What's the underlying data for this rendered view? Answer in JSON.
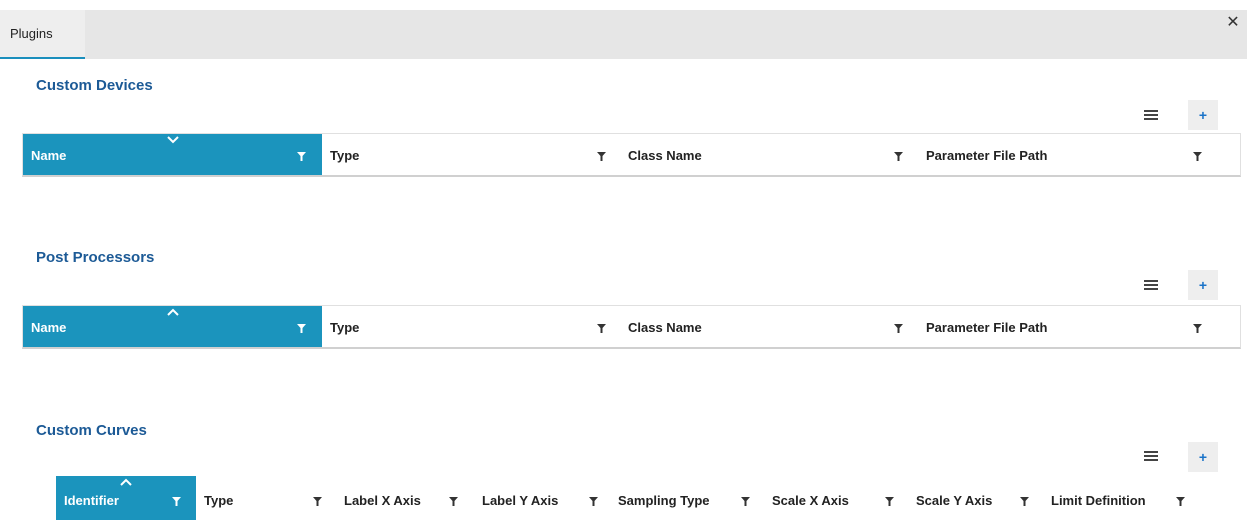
{
  "tab": {
    "label": "Plugins"
  },
  "sections": [
    {
      "title": "Custom Devices",
      "sort": "desc",
      "columns": [
        "Name",
        "Type",
        "Class Name",
        "Parameter File Path"
      ]
    },
    {
      "title": "Post Processors",
      "sort": "asc",
      "columns": [
        "Name",
        "Type",
        "Class Name",
        "Parameter File Path"
      ]
    },
    {
      "title": "Custom Curves",
      "sort": "asc",
      "columns": [
        "Identifier",
        "Type",
        "Label X Axis",
        "Label Y Axis",
        "Sampling Type",
        "Scale X Axis",
        "Scale Y Axis",
        "Limit Definition"
      ]
    }
  ],
  "toolbar": {
    "add_label": "+"
  },
  "colors": {
    "accent": "#1b94bd",
    "title": "#1c5a96"
  }
}
